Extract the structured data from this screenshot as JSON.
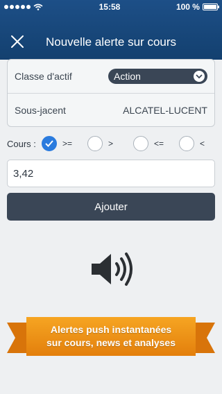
{
  "status": {
    "time": "15:58",
    "battery": "100 %"
  },
  "header": {
    "title": "Nouvelle alerte sur cours",
    "close_icon": "close-icon"
  },
  "form": {
    "asset_class_label": "Classe d'actif",
    "asset_class_value": "Action",
    "underlying_label": "Sous-jacent",
    "underlying_value": "ALCATEL-LUCENT",
    "cours_label": "Cours :",
    "operators": [
      {
        "label": ">=",
        "checked": true
      },
      {
        "label": ">",
        "checked": false
      },
      {
        "label": "<=",
        "checked": false
      },
      {
        "label": "<",
        "checked": false
      }
    ],
    "price_value": "3,42",
    "submit_label": "Ajouter"
  },
  "illustration": {
    "icon": "speaker-icon"
  },
  "banner": {
    "line1": "Alertes push instantanées",
    "line2": "sur cours, news et analyses"
  },
  "colors": {
    "header": "#1d4f87",
    "button": "#3a4656",
    "checked": "#2a7bde",
    "banner": "#f39a1c"
  }
}
